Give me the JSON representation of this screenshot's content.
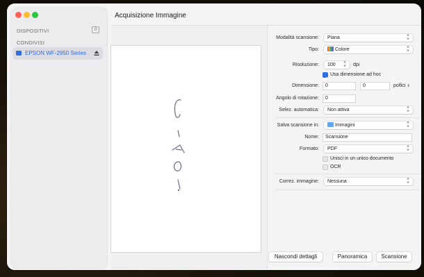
{
  "window": {
    "title": "Acquisizione Immagine"
  },
  "sidebar": {
    "devices_label": "DISPOSITIVI",
    "devices_count": "0",
    "shared_label": "CONDIVISI",
    "device_name": "EPSON WF-2950 Series"
  },
  "preview": {
    "handwritten_text": "CIAO!"
  },
  "settings": {
    "mode_label": "Modalità scansione:",
    "mode_value": "Piana",
    "type_label": "Tipo:",
    "type_value": "Colore",
    "resolution_label": "Risoluzione:",
    "resolution_value": "100",
    "resolution_unit": "dpi",
    "custom_size_label": "Usa dimensione ad hoc",
    "custom_size_checked": true,
    "size_label": "Dimensione:",
    "size_width": "0",
    "size_height": "0",
    "size_unit": "pollici",
    "rotation_label": "Angolo di rotazione:",
    "rotation_value": "0",
    "autoselect_label": "Selez. automatica:",
    "autoselect_value": "Non attiva",
    "save_label": "Salva scansione in:",
    "save_value": "Immagini",
    "name_label": "Nome:",
    "name_value": "Scansione",
    "format_label": "Formato:",
    "format_value": "PDF",
    "combine_label": "Unisci in un unico documento",
    "combine_checked": false,
    "ocr_label": "OCR",
    "ocr_checked": false,
    "correction_label": "Correz. immagine:",
    "correction_value": "Nessuna"
  },
  "buttons": {
    "hide_details": "Nascondi dettagli",
    "overview": "Panoramica",
    "scan": "Scansione"
  },
  "colors": {
    "accent": "#2f6fe0",
    "close": "#fe5f57",
    "minimize": "#febc2e",
    "maximize": "#28c840"
  }
}
